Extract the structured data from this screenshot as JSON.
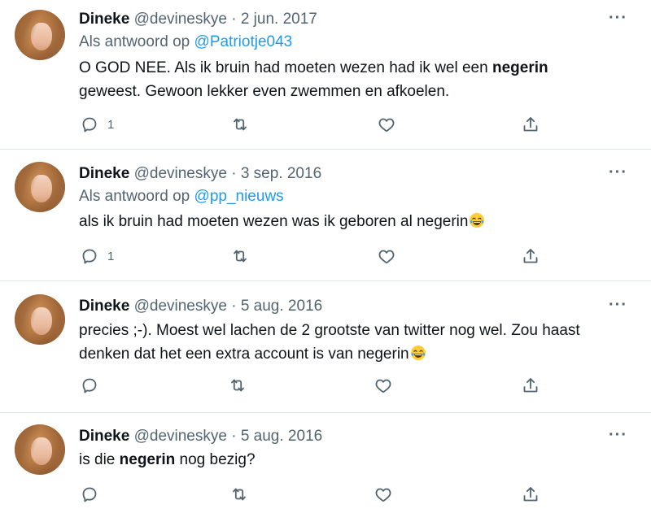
{
  "tweets": [
    {
      "name": "Dineke",
      "handle": "@devineskye",
      "separator": "·",
      "date": "2 jun. 2017",
      "reply_prefix": "Als antwoord op",
      "reply_to": "@Patriotje043",
      "text_line1_before": "O GOD NEE. Als ik bruin had moeten wezen had ik wel een ",
      "text_line1_bold": "negerin",
      "text_line2": "geweest. Gewoon lekker even zwemmen en afkoelen.",
      "reply_count": "1"
    },
    {
      "name": "Dineke",
      "handle": "@devineskye",
      "separator": "·",
      "date": "3 sep. 2016",
      "reply_prefix": "Als antwoord op",
      "reply_to": "@pp_nieuws",
      "text": "als ik bruin had moeten wezen was ik geboren al negerin",
      "emoji": "face-with-tears-of-joy",
      "reply_count": "1"
    },
    {
      "name": "Dineke",
      "handle": "@devineskye",
      "separator": "·",
      "date": "5 aug. 2016",
      "text_line1": "precies ;-). Moest wel lachen de 2 grootste van twitter nog wel. Zou haast",
      "text_line2": "denken dat het een extra account is van negerin",
      "emoji": "face-with-tears-of-joy"
    },
    {
      "name": "Dineke",
      "handle": "@devineskye",
      "separator": "·",
      "date": "5 aug. 2016",
      "text_before": "is die ",
      "text_bold": "negerin",
      "text_after": " nog bezig?"
    }
  ],
  "more_label": "···",
  "icons": [
    "reply-icon",
    "retweet-icon",
    "like-icon",
    "share-icon",
    "more-icon",
    "avatar"
  ],
  "colors": {
    "text": "#0f1419",
    "secondary": "#536471",
    "link": "#1d9bf0",
    "divider": "#dfe4e8"
  }
}
